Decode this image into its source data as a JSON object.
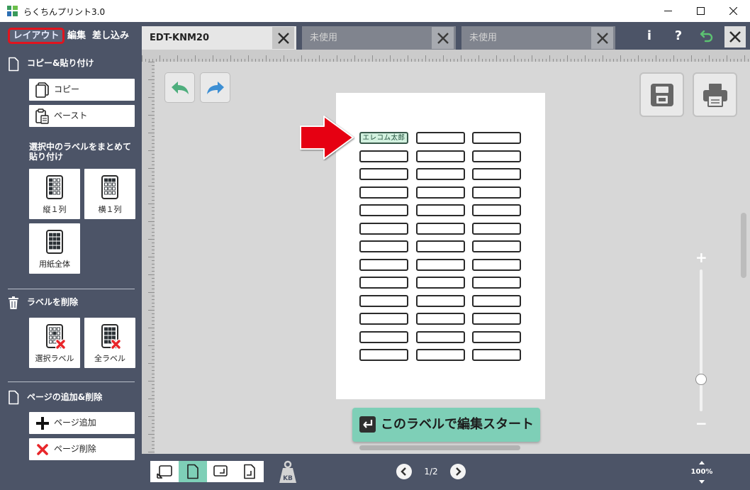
{
  "window": {
    "title": "らくちんプリント3.0",
    "icons": [
      "app-icon",
      "minimize-icon",
      "maximize-icon",
      "close-icon"
    ]
  },
  "mode_tabs": [
    {
      "label": "レイアウト",
      "active": true
    },
    {
      "label": "編集",
      "active": false
    },
    {
      "label": "差し込み",
      "active": false
    }
  ],
  "doc_tabs": [
    {
      "label": "EDT-KNM20",
      "active": true
    },
    {
      "label": "未使用",
      "active": false
    },
    {
      "label": "未使用",
      "active": false
    }
  ],
  "toolbar": {
    "info_label": "i",
    "help_label": "?",
    "icons": [
      "return-icon",
      "close-icon"
    ]
  },
  "sidebar": {
    "copy_section": {
      "title": "コピー&貼り付け",
      "copy": "コピー",
      "paste": "ペースト"
    },
    "bulk_paste": {
      "title_line1": "選択中のラベルをまとめて",
      "title_line2": "貼り付け",
      "vertical": "縦１列",
      "horizontal": "横１列",
      "full_sheet": "用紙全体"
    },
    "delete_section": {
      "title": "ラベルを削除",
      "selected": "選択ラベル",
      "all": "全ラベル"
    },
    "page_section": {
      "title": "ページの追加&削除",
      "add": "ページ追加",
      "remove": "ページ削除"
    }
  },
  "canvas": {
    "tools": [
      "undo-icon",
      "redo-icon",
      "save-icon",
      "print-icon"
    ],
    "sheet": {
      "columns": 3,
      "rows": 13,
      "labels": [
        {
          "text": "エレコム太郎",
          "selected": true
        }
      ]
    },
    "pointer_icon": "red-arrow-icon",
    "zoom_slider_level": 0.225,
    "start_button_label": "このラベルで編集スタート"
  },
  "footer": {
    "orientation_options": [
      {
        "icon": "rotate-left-icon",
        "active": false
      },
      {
        "icon": "portrait-page-icon",
        "active": true
      },
      {
        "icon": "rotate-right-icon",
        "active": false
      },
      {
        "icon": "flip-page-icon",
        "active": false
      }
    ],
    "weight_label": "KB",
    "page_indicator": "1/2",
    "zoom": "100%"
  },
  "colors": {
    "chrome": "#4c5467",
    "accent_mint": "#7ecfb7",
    "selected_label_fill": "#d2f1df",
    "alert_red": "#e60012"
  }
}
